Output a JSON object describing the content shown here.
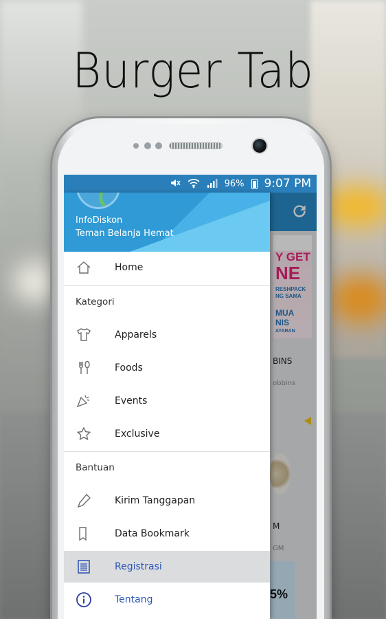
{
  "headline": "Burger Tab",
  "status_bar": {
    "battery_percent": "96%",
    "time": "9:07 PM"
  },
  "drawer": {
    "app_name": "InfoDiskon",
    "tagline": "Teman Belanja Hemat",
    "home": {
      "label": "Home",
      "icon": "home-icon"
    },
    "sections": {
      "kategori": "Kategori",
      "bantuan": "Bantuan"
    },
    "kategori_items": [
      {
        "label": "Apparels",
        "icon": "shirt-icon"
      },
      {
        "label": "Foods",
        "icon": "fork-spoon-icon"
      },
      {
        "label": "Events",
        "icon": "party-icon"
      },
      {
        "label": "Exclusive",
        "icon": "star-icon"
      }
    ],
    "bantuan_items": [
      {
        "label": "Kirim Tanggapan",
        "icon": "pencil-icon"
      },
      {
        "label": "Data Bookmark",
        "icon": "bookmark-icon"
      },
      {
        "label": "Registrasi",
        "icon": "document-list-icon",
        "active": true
      },
      {
        "label": "Tentang",
        "icon": "info-icon"
      }
    ]
  },
  "background_app": {
    "promo_lines": [
      "Y GET",
      "NE",
      "RESHPACK",
      "NG SAMA",
      "MUA",
      "NIS",
      "AYARAN"
    ],
    "card1_title": "BINS",
    "card1_sub": "obbins",
    "card2_title": "M",
    "card2_sub": "GM",
    "ad_text": "5%"
  },
  "colors": {
    "primary": "#2a8bca",
    "active_text": "#2c55b8",
    "active_bg": "#dadcde"
  }
}
